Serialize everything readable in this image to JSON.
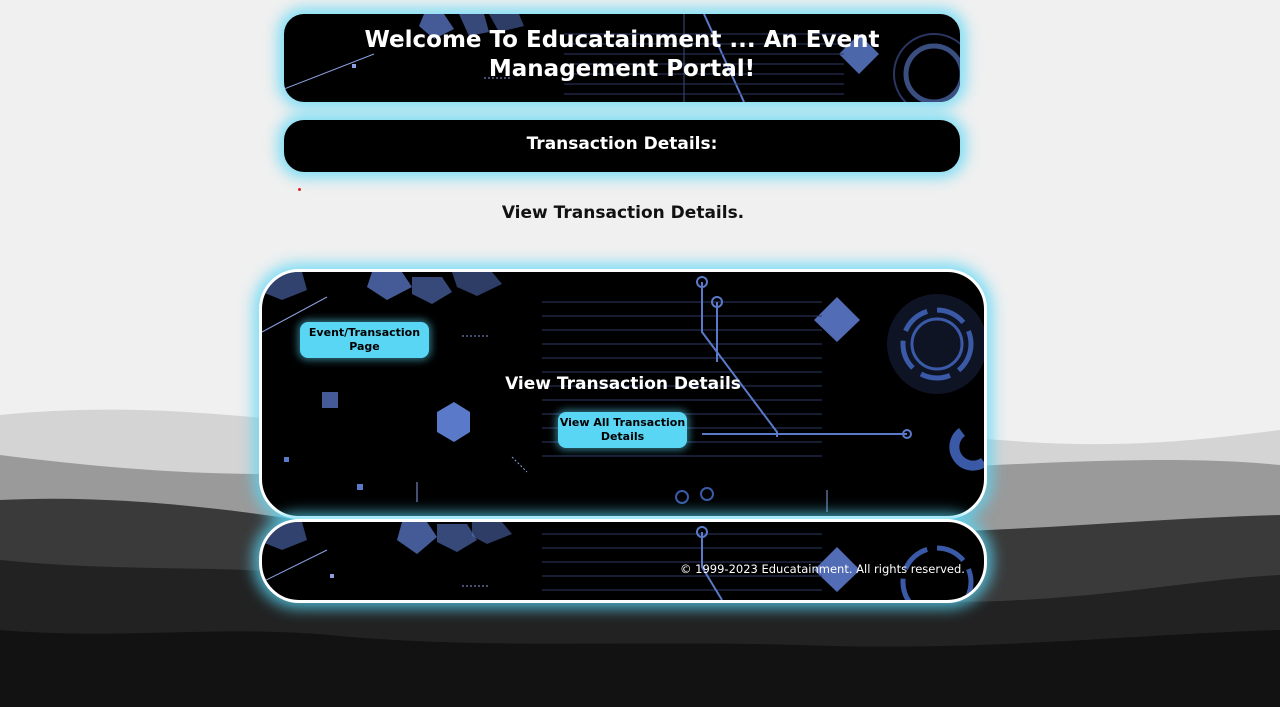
{
  "header": {
    "title": "Welcome To Educatainment ... An Event Management Portal!"
  },
  "section": {
    "heading": "Transaction Details:"
  },
  "subtitle": "View Transaction Details.",
  "card": {
    "heading": "View Transaction Details",
    "event_button_label": "Event/Transaction Page",
    "view_all_button_label": "View All Transaction Details"
  },
  "footer": {
    "copyright": "© 1999-2023 Educatainment. All rights reserved."
  },
  "colors": {
    "accent": "#59d6f4",
    "panel_bg": "#000000",
    "tech_blue": "#5b79c9"
  }
}
